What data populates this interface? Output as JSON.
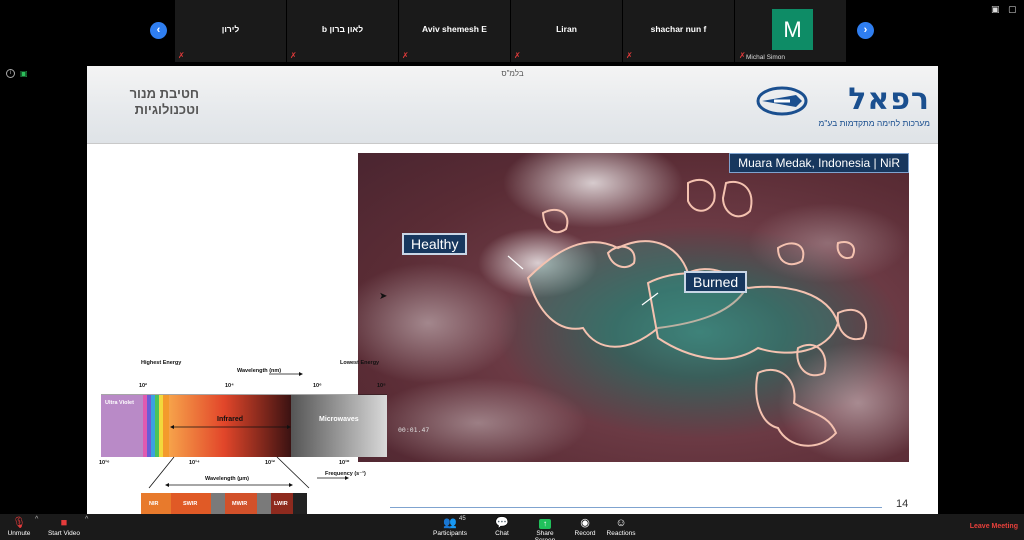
{
  "participants": [
    {
      "name": "לירון"
    },
    {
      "name": "b לאון ברון"
    },
    {
      "name": "Aviv shemesh E"
    },
    {
      "name": "Liran"
    },
    {
      "name": "shachar nun f"
    }
  ],
  "self_view": {
    "initial": "M",
    "name": "Michal Simon"
  },
  "slide": {
    "classification": "בלמ\"ס",
    "title_line1": "חטיבת מנור",
    "title_line2": "וטכנולוגיות",
    "logo_word": "רפאל",
    "logo_sub": "מערכות לחימה מתקדמות בע\"מ",
    "photo_title": "Muara Medak, Indonesia | NiR",
    "label_healthy": "Healthy",
    "label_burned": "Burned",
    "timecode": "00:01.47",
    "page_number": "14",
    "spectrum": {
      "highest_energy": "Highest Energy",
      "lowest_energy": "Lowest Energy",
      "wavelength_nm": "Wavelength (nm)",
      "tick_1": "10²",
      "tick_2": "10⁴",
      "tick_3": "10⁶",
      "tick_4": "10⁸",
      "ultra_violet": "Ultra Violet",
      "infrared": "Infrared",
      "microwaves": "Microwaves",
      "freq_1": "10¹⁶",
      "freq_2": "10¹⁴",
      "freq_3": "10¹²",
      "freq_4": "10¹⁰",
      "frequency": "Frequency (s⁻¹)",
      "wavelength_um": "Wavelength (µm)",
      "bands": [
        "NIR",
        "SWIR",
        "MWIR",
        "LWIR"
      ]
    }
  },
  "toolbar": {
    "unmute": "Unmute",
    "start_video": "Start Video",
    "participants": "Participants",
    "participant_count": "45",
    "chat": "Chat",
    "share_screen": "Share Screen",
    "record": "Record",
    "reactions": "Reactions",
    "leave": "Leave Meeting"
  },
  "colors": {
    "accent": "#2f7ef0",
    "leave": "#e8403b",
    "avatar": "#0e8c66",
    "slide_blue": "#17375e"
  }
}
